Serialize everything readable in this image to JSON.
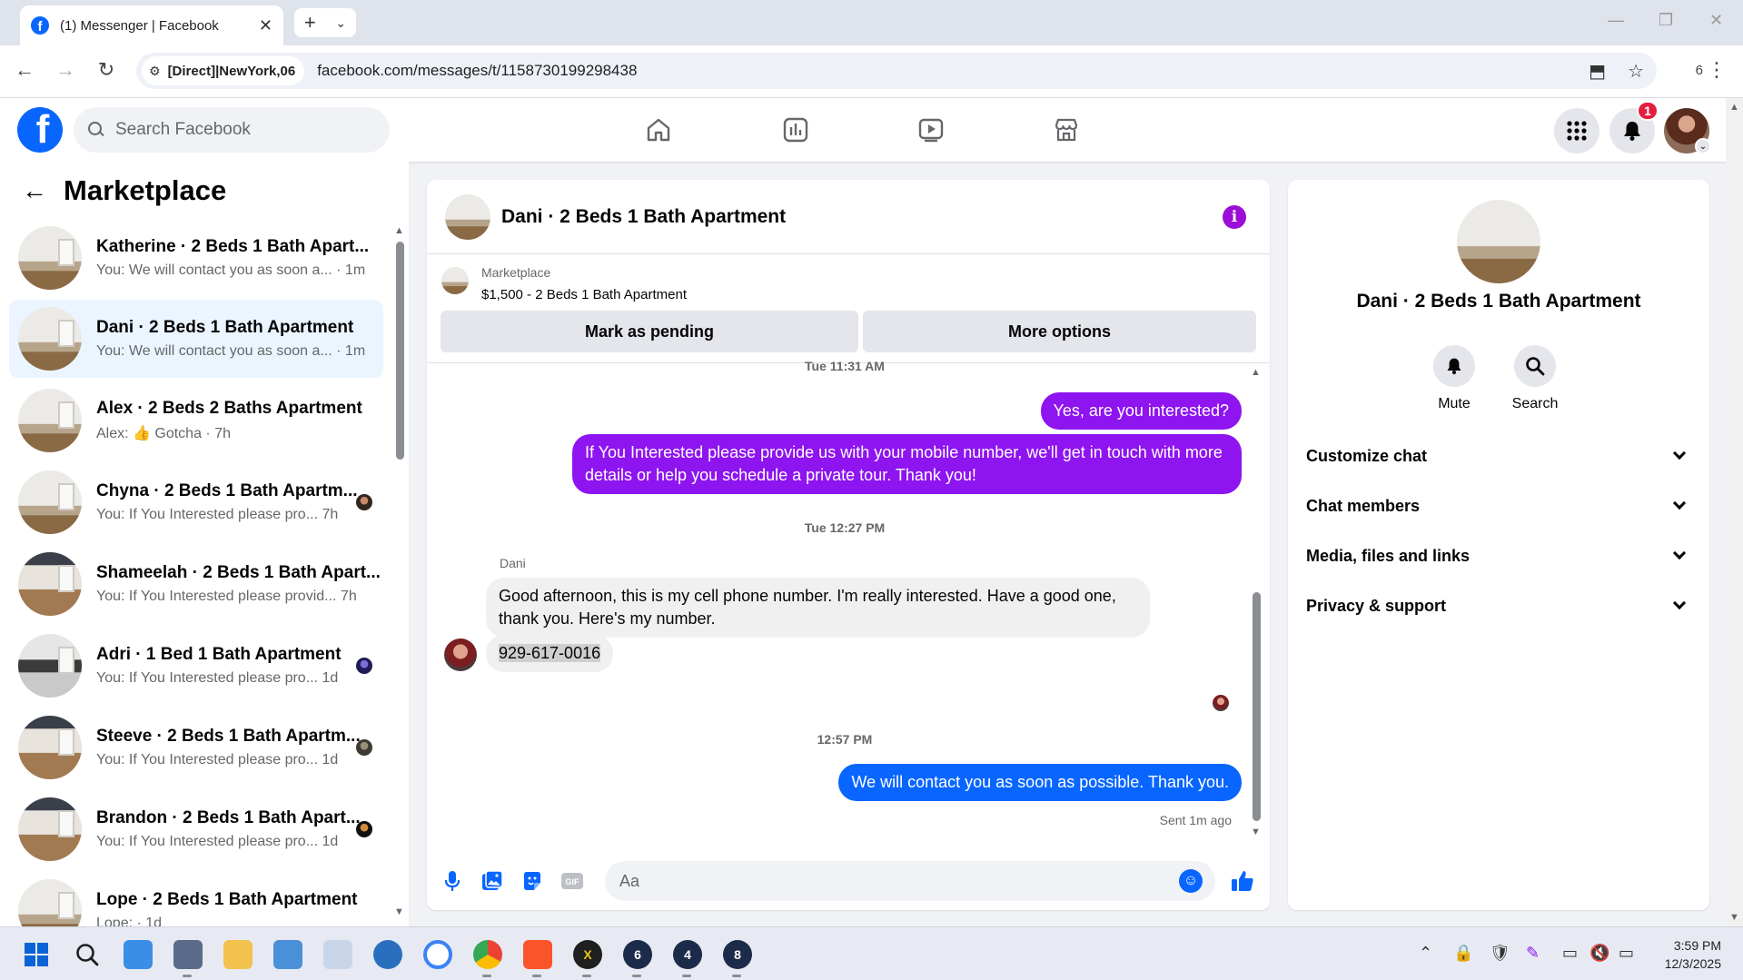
{
  "browser": {
    "tab_title": "(1) Messenger | Facebook",
    "site_chip": "[Direct]|NewYork,06",
    "url": "facebook.com/messages/t/1158730199298438",
    "extension_count": "6"
  },
  "fb_header": {
    "logo": "f",
    "search_placeholder": "Search Facebook",
    "notification_count": "1"
  },
  "left_pane": {
    "title": "Marketplace",
    "conversations": [
      {
        "name": "Katherine · 2 Beds 1 Bath Apart...",
        "snippet": "You: We will contact you as soon a... · 1m"
      },
      {
        "name": "Dani · 2 Beds 1 Bath Apartment",
        "snippet": "You: We will contact you as soon a... · 1m"
      },
      {
        "name": "Alex · 2 Beds 2 Baths Apartment",
        "snippet": "Alex: 👍 Gotcha · 7h"
      },
      {
        "name": "Chyna · 2 Beds 1 Bath Apartm...",
        "snippet": "You: If You Interested please pro...   7h"
      },
      {
        "name": "Shameelah · 2 Beds 1 Bath Apart...",
        "snippet": "You: If You Interested please provid...   7h"
      },
      {
        "name": "Adri · 1 Bed 1 Bath Apartment",
        "snippet": "You: If You Interested please pro...   1d"
      },
      {
        "name": "Steeve · 2 Beds 1 Bath Apartm...",
        "snippet": "You: If You Interested please pro...   1d"
      },
      {
        "name": "Brandon · 2 Beds 1 Bath Apart...",
        "snippet": "You: If You Interested please pro...   1d"
      },
      {
        "name": "Lope · 2 Beds 1 Bath Apartment",
        "snippet": "Lope: · 1d"
      }
    ]
  },
  "chat": {
    "title": "Dani · 2 Beds 1 Bath Apartment",
    "marketplace_label": "Marketplace",
    "listing": "$1,500 - 2 Beds 1 Bath Apartment",
    "mark_pending": "Mark as pending",
    "more_options": "More options",
    "top_timestamp": "Tue 11:31 AM",
    "msg_out_1": "Yes, are you interested?",
    "msg_out_2": "If You Interested please provide us with your mobile number, we'll get in touch with more details or help you schedule a private tour. Thank you!",
    "timestamp_1": "Tue 12:27 PM",
    "sender_name": "Dani",
    "msg_in_1": "Good afternoon, this is my cell phone number. I'm really interested. Have a good one, thank you. Here's my number.",
    "msg_in_2": "929-617-0016",
    "timestamp_2": "12:57 PM",
    "msg_out_3": "We will contact you as soon as possible. Thank you.",
    "sent_status": "Sent 1m ago",
    "composer_placeholder": "Aa"
  },
  "right_pane": {
    "title": "Dani · 2 Beds 1 Bath Apartment",
    "mute_label": "Mute",
    "search_label": "Search",
    "rows": [
      "Customize chat",
      "Chat members",
      "Media, files and links",
      "Privacy & support"
    ]
  },
  "taskbar": {
    "time": "3:59 PM",
    "date": "12/3/2025",
    "badges": [
      "6",
      "4",
      "8"
    ]
  },
  "colors": {
    "fb_blue": "#0866ff",
    "purple_bubble": "#8e14f0",
    "info_purple": "#9b0ed6",
    "active_row": "#ebf5ff",
    "badge_red": "#e41e3f"
  }
}
